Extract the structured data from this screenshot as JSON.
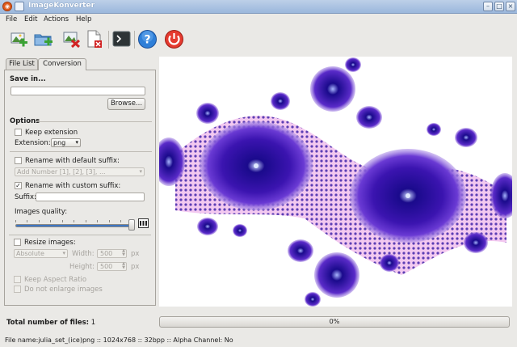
{
  "window": {
    "title": "ImageKonverter"
  },
  "menu": {
    "items": [
      "File",
      "Edit",
      "Actions",
      "Help"
    ]
  },
  "toolbar": {
    "buttons": [
      "add-images-icon",
      "add-folder-icon",
      "remove-images-icon",
      "clear-list-icon",
      "terminal-icon",
      "help-icon",
      "quit-icon"
    ]
  },
  "tabs": {
    "file_list": "File List",
    "conversion": "Conversion"
  },
  "save_in": {
    "label": "Save in...",
    "path_value": "",
    "browse_label": "Browse..."
  },
  "options": {
    "heading": "Options",
    "keep_extension_label": "Keep extension",
    "extension_label": "Extension:",
    "extension_value": "png",
    "rename_default_label": "Rename with default suffix:",
    "default_suffix_value": "Add Number [1], [2], [3], ...",
    "rename_custom_label": "Rename with custom suffix:",
    "suffix_label": "Suffix:",
    "suffix_value": "",
    "quality_label": "Images quality:",
    "quality_level": 1.0,
    "resize_label": "Resize images:",
    "resize_mode": "Absolute",
    "width_label": "Width:",
    "width_value": "500",
    "height_label": "Height:",
    "height_value": "500",
    "unit_px": "px",
    "keep_aspect_label": "Keep Aspect Ratio",
    "no_enlarge_label": "Do not enlarge images",
    "keep_extension_checked": false,
    "rename_default_checked": false,
    "rename_custom_checked": true,
    "resize_checked": false,
    "keep_aspect_checked": false,
    "no_enlarge_checked": false
  },
  "footer": {
    "total_label": "Total number of files:",
    "total_value": "1",
    "progress_text": "0%",
    "progress_value": 0
  },
  "status": {
    "text": "File name:julia_set_(ice)png :: 1024x768 :: 32bpp :: Alpha Channel: No"
  },
  "colors": {
    "fractal_dark": "#1a0a8c",
    "fractal_mid": "#5a2bc9",
    "fractal_light": "#f3c9f0",
    "selection": "#3e76c3"
  }
}
